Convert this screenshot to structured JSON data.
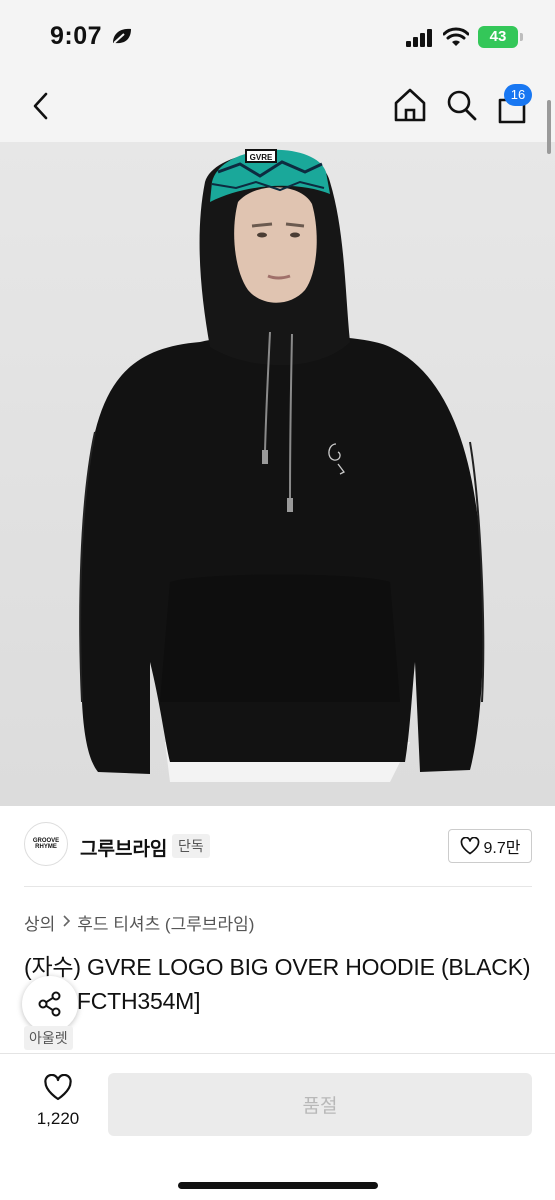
{
  "status_bar": {
    "time": "9:07",
    "battery": "43"
  },
  "header": {
    "cart_count": "16"
  },
  "brand": {
    "logo_text": "GROOVE RHYME",
    "name": "그루브라임",
    "tag": "단독",
    "like_count": "9.7만"
  },
  "breadcrumb": {
    "items": [
      "상의",
      "후드 티셔츠 (그루브라임)"
    ]
  },
  "product": {
    "title": "(자수) GVRE LOGO BIG OVER HOODIE (BLACK) [LRQFCTH354M]",
    "badge": "아울렛",
    "image_logo_text": "GVRE"
  },
  "bottom_bar": {
    "wish_count": "1,220",
    "soldout_label": "품절"
  },
  "colors": {
    "accent_blue": "#1877f2",
    "battery_green": "#34c759",
    "hoodie": "#121212",
    "image_bg": "#e2e2e2",
    "cap_teal": "#1aa89a"
  }
}
